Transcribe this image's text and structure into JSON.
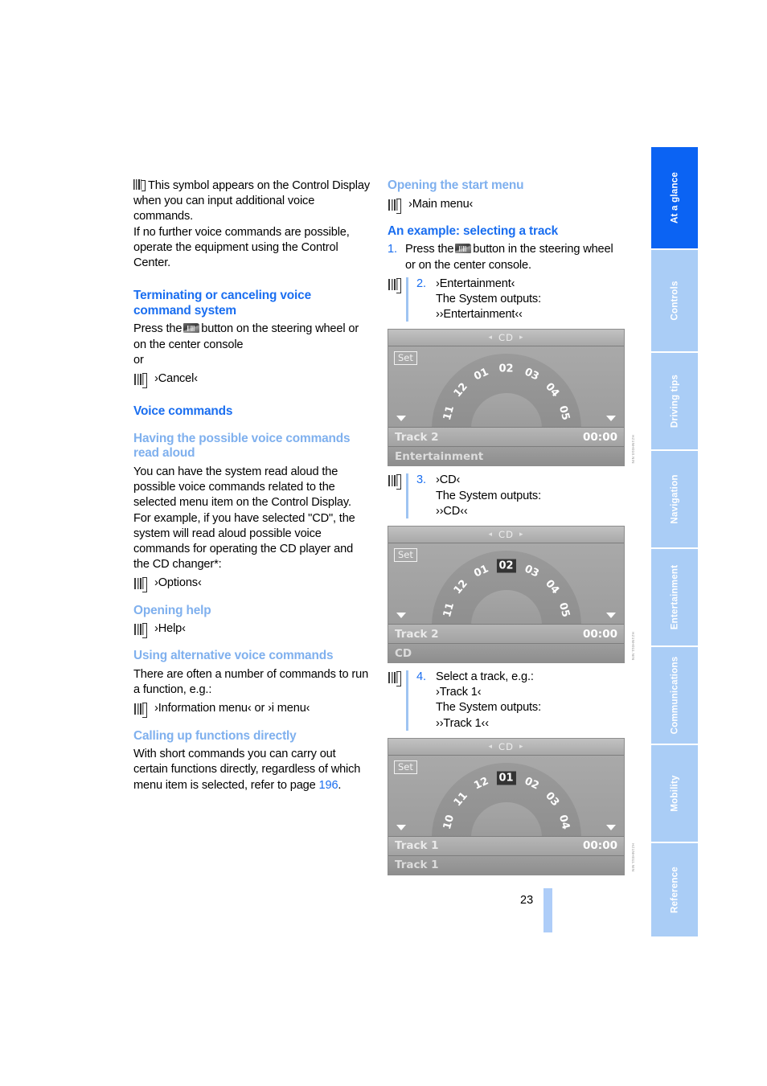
{
  "page": {
    "number": "23",
    "accent_blue": "#1a6ef0",
    "accent_light_blue": "#7fb0ee",
    "rail_blue": "#aacdf6",
    "rail_active_blue": "#0b63f3"
  },
  "left_column": {
    "intro": {
      "icon": "voice-input-symbol-icon",
      "text": "This symbol appears on the Control Display when you can input additional voice commands.",
      "text2": "If no further voice commands are possible, operate the equipment using the Control Center."
    },
    "section_terminate": {
      "heading": "Terminating or canceling voice command system",
      "line1_before": "Press the",
      "line1_icon": "voice-button-icon",
      "line1_after": "button on the steering wheel or on the center console",
      "or": "or",
      "command": "›Cancel‹"
    },
    "section_voice_commands": {
      "heading": "Voice commands"
    },
    "section_read_aloud": {
      "heading": "Having the possible voice commands read aloud",
      "paragraph1": "You can have the system read aloud the possible voice commands related to the selected menu item on the Control Display.",
      "paragraph2": "For example, if you have selected \"CD\", the system will read aloud possible voice commands for operating the CD player and the CD changer*:",
      "command": "›Options‹"
    },
    "section_help": {
      "heading": "Opening help",
      "command": "›Help‹"
    },
    "section_alternative": {
      "heading": "Using alternative voice commands",
      "paragraph": "There are often a number of commands to run a function, e.g.:",
      "command": "›Information menu‹ or ›i menu‹"
    },
    "section_direct": {
      "heading": "Calling up functions directly",
      "paragraph_before": "With short commands you can carry out certain functions directly, regardless of which menu item is selected, refer to page ",
      "page_ref": "196",
      "paragraph_after": "."
    }
  },
  "right_column": {
    "section_start_menu": {
      "heading": "Opening the start menu",
      "command": "›Main menu‹"
    },
    "section_example": {
      "heading": "An example: selecting a track",
      "steps": [
        {
          "num": "1.",
          "kind": "plain",
          "text_before": "Press the",
          "icon": "voice-button-icon",
          "text_after": "button in the steering wheel or on the center console."
        },
        {
          "num": "2.",
          "kind": "voice",
          "command": "›Entertainment‹",
          "outputs_label": "The System outputs:",
          "output": "››Entertainment‹‹"
        },
        {
          "num": "3.",
          "kind": "voice",
          "command": "›CD‹",
          "outputs_label": "The System outputs:",
          "output": "››CD‹‹"
        },
        {
          "num": "4.",
          "kind": "voice",
          "command_intro": "Select a track, e.g.:",
          "command": "›Track 1‹",
          "outputs_label": "The System outputs:",
          "output": "››Track 1‹‹"
        }
      ]
    },
    "figures": [
      {
        "name": "cd-display-entertainment",
        "header": "CD",
        "left_arrow": "◂",
        "right_arrow": "▸",
        "set_label": "Set",
        "ticks": [
          "11",
          "12",
          "01",
          "02",
          "03",
          "04",
          "05"
        ],
        "selected": null,
        "track_label": "Track 2",
        "time": "00:00",
        "status": "Entertainment",
        "code": "HZ1NH010.NIN"
      },
      {
        "name": "cd-display-cd",
        "header": "CD",
        "left_arrow": "◂",
        "right_arrow": "▸",
        "set_label": "Set",
        "ticks": [
          "11",
          "12",
          "01",
          "02",
          "03",
          "04",
          "05"
        ],
        "selected": "02",
        "track_label": "Track 2",
        "time": "00:00",
        "status": "CD",
        "code": "HZ1NH011.NIN"
      },
      {
        "name": "cd-display-track1",
        "header": "CD",
        "left_arrow": "◂",
        "right_arrow": "▸",
        "set_label": "Set",
        "ticks": [
          "10",
          "11",
          "12",
          "01",
          "02",
          "03",
          "04"
        ],
        "selected": "01",
        "track_label": "Track 1",
        "time": "00:00",
        "status": "Track 1",
        "code": "HZ1NH011.NIN"
      }
    ]
  },
  "rail": {
    "tabs": [
      {
        "label": "At a glance",
        "active": true
      },
      {
        "label": "Controls",
        "active": false
      },
      {
        "label": "Driving tips",
        "active": false
      },
      {
        "label": "Navigation",
        "active": false
      },
      {
        "label": "Entertainment",
        "active": false
      },
      {
        "label": "Communications",
        "active": false
      },
      {
        "label": "Mobility",
        "active": false
      },
      {
        "label": "Reference",
        "active": false
      }
    ]
  }
}
